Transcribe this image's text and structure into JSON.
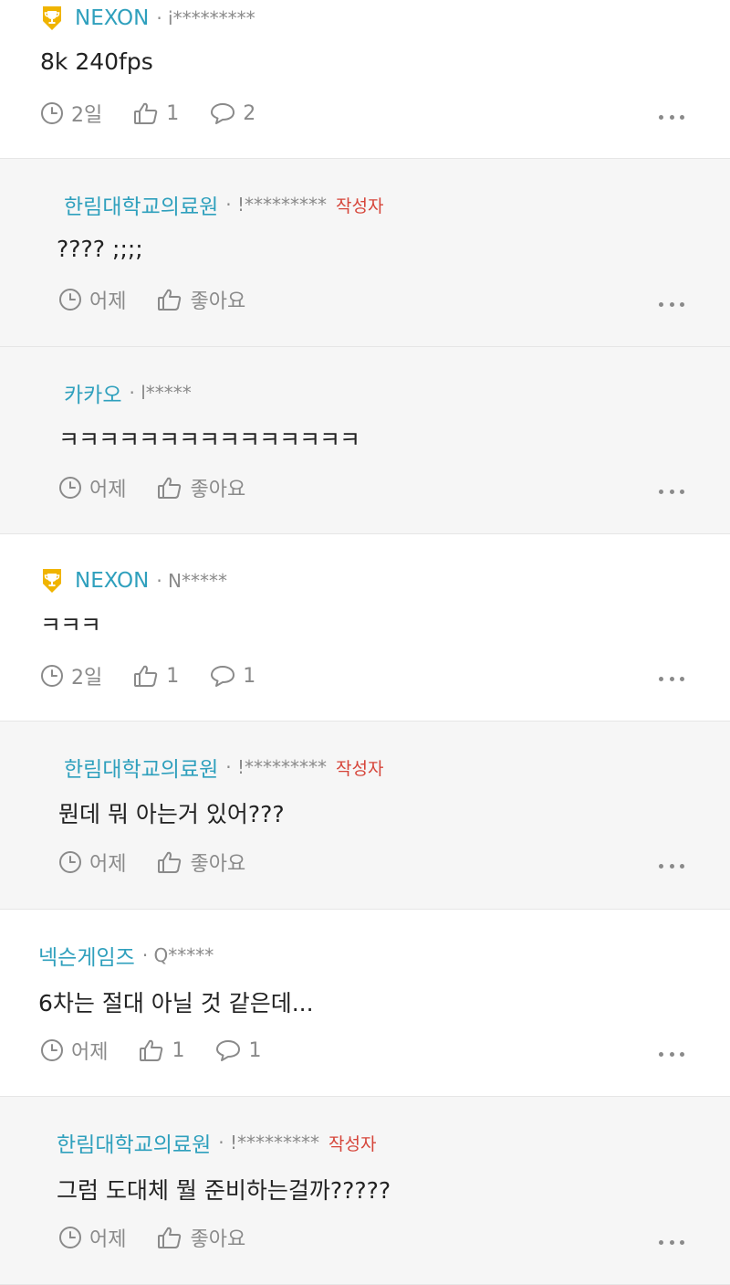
{
  "comments": [
    {
      "author": "NEXON",
      "masked_id": "· i*********",
      "body": "8k 240fps",
      "time": "2일",
      "likes": "1",
      "replies": "2",
      "badge": "trophy-icon"
    },
    {
      "author": "한림대학교의료원",
      "masked_id": "· !*********",
      "op_label": "작성자",
      "body": "???? ;;;;",
      "time": "어제",
      "like_label": "좋아요"
    },
    {
      "author": "카카오",
      "masked_id": "· l*****",
      "body": "ㅋㅋㅋㅋㅋㅋㅋㅋㅋㅋㅋㅋㅋㅋㅋ",
      "time": "어제",
      "like_label": "좋아요"
    },
    {
      "author": "NEXON",
      "masked_id": "· N*****",
      "body": "ㅋㅋㅋ",
      "time": "2일",
      "likes": "1",
      "replies": "1",
      "badge": "trophy-icon"
    },
    {
      "author": "한림대학교의료원",
      "masked_id": "· !*********",
      "op_label": "작성자",
      "body": "뭔데 뭐 아는거 있어???",
      "time": "어제",
      "like_label": "좋아요"
    },
    {
      "author": "넥슨게임즈",
      "masked_id": "· Q*****",
      "body": "6차는 절대 아닐 것 같은데...",
      "time": "어제",
      "likes": "1",
      "replies": "1"
    },
    {
      "author": "한림대학교의료원",
      "masked_id": "· !*********",
      "op_label": "작성자",
      "body": "그럼 도대체 뭘 준비하는걸까?????",
      "time": "어제",
      "like_label": "좋아요"
    }
  ],
  "colors": {
    "author": "#2fa0bd",
    "op_tag": "#d6453a",
    "meta": "#8a8a8a",
    "reply_bg": "#f6f6f6"
  },
  "icons": {
    "time": "clock-icon",
    "like": "thumbs-up-icon",
    "reply": "speech-bubble-icon",
    "more": "more-dots-icon"
  }
}
